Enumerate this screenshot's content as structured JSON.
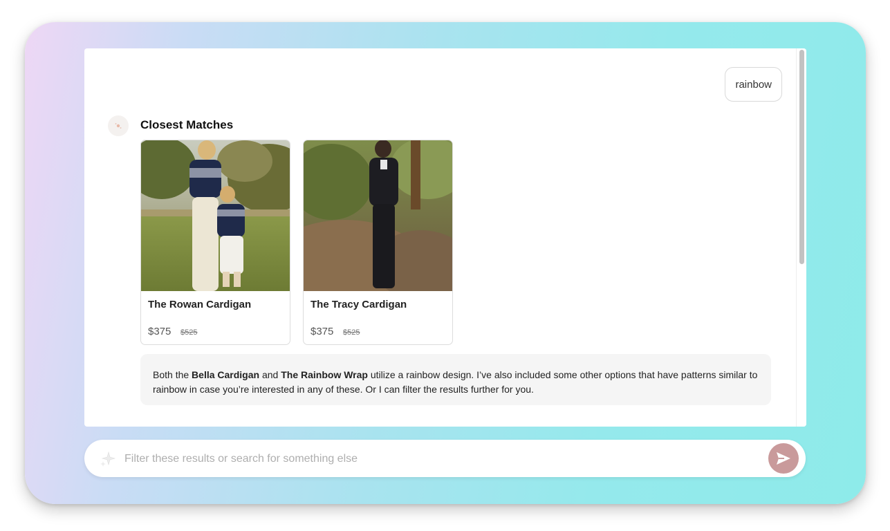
{
  "conversation": {
    "user_query": "rainbow",
    "section_title": "Closest Matches"
  },
  "products": [
    {
      "name": "The Rowan Cardigan",
      "price": "$375",
      "original_price": "$525"
    },
    {
      "name": "The Tracy Cardigan",
      "price": "$375",
      "original_price": "$525"
    }
  ],
  "assistant_message": {
    "part1": "Both the ",
    "product1": "Bella Cardigan",
    "part2": " and ",
    "product2": "The Rainbow Wrap",
    "part3": " utilize a rainbow  design. I’ve also included some other options that have patterns similar to rainbow in case you’re interested in any of these. Or I can filter the results further for you."
  },
  "search": {
    "placeholder": "Filter these results or search for something else",
    "value": ""
  },
  "icons": {
    "avatar": "sparkle-avatar-icon",
    "search_leading": "sparkle-icon",
    "send": "send-icon"
  },
  "colors": {
    "send_button": "#c99a9b",
    "message_background": "#f5f5f5"
  }
}
